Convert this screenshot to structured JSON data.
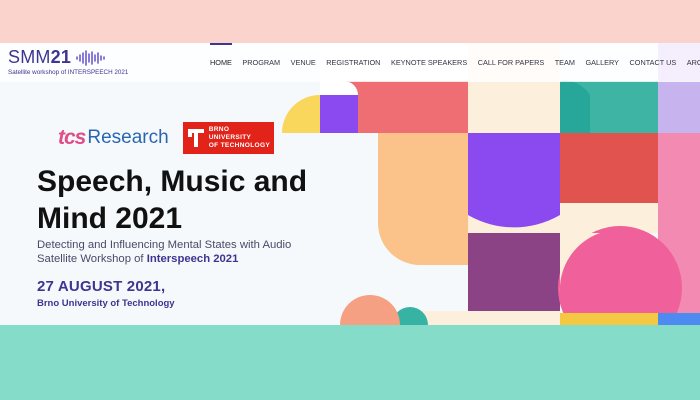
{
  "header": {
    "logo_text_light": "SMM",
    "logo_text_bold": "21",
    "logo_subtitle": "Satellite workshop of INTERSPEECH 2021",
    "nav": [
      {
        "label": "HOME",
        "active": true
      },
      {
        "label": "PROGRAM",
        "active": false
      },
      {
        "label": "VENUE",
        "active": false
      },
      {
        "label": "REGISTRATION",
        "active": false
      },
      {
        "label": "KEYNOTE SPEAKERS",
        "active": false
      },
      {
        "label": "CALL FOR PAPERS",
        "active": false
      },
      {
        "label": "TEAM",
        "active": false
      },
      {
        "label": "GALLERY",
        "active": false
      },
      {
        "label": "CONTACT US",
        "active": false
      },
      {
        "label": "ARCHIVE",
        "active": false
      }
    ]
  },
  "hero": {
    "sponsor_tcs_mark": "tcs",
    "sponsor_tcs_word": "Research",
    "sponsor_brno_lines": [
      "BRNO",
      "UNIVERSITY",
      "OF TECHNOLOGY"
    ],
    "title_line1": "Speech, Music and",
    "title_line2": "Mind 2021",
    "subtitle_line1": "Detecting and Influencing Mental States with Audio",
    "subtitle_prefix": "Satellite Workshop of ",
    "subtitle_bold": "Interspeech 2021",
    "date": "27 AUGUST 2021,",
    "place": "Brno University of Technology"
  },
  "colors": {
    "brand": "#3d3590",
    "band_top": "#fbd3cd",
    "band_bottom": "#84dcc9",
    "brno_red": "#e2231a",
    "tcs_pink": "#e04e8a",
    "tcs_blue": "#2a66b0"
  }
}
